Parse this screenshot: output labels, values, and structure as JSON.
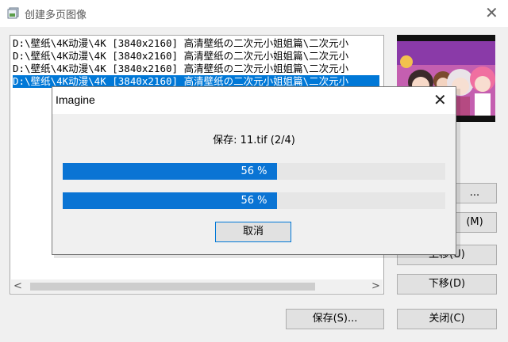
{
  "window": {
    "title": "创建多页图像"
  },
  "file_list": {
    "items": [
      {
        "text": "D:\\壁纸\\4K动漫\\4K [3840x2160] 高清壁纸の二次元小姐姐篇\\二次元小",
        "selected": false
      },
      {
        "text": "D:\\壁纸\\4K动漫\\4K [3840x2160] 高清壁纸の二次元小姐姐篇\\二次元小",
        "selected": false
      },
      {
        "text": "D:\\壁纸\\4K动漫\\4K [3840x2160] 高清壁纸の二次元小姐姐篇\\二次元小",
        "selected": false
      },
      {
        "text": "D:\\壁纸\\4K动漫\\4K [3840x2160] 高清壁纸の二次元小姐姐篇\\二次元小",
        "selected": true
      }
    ],
    "scroll_left": "<",
    "scroll_right": ">"
  },
  "side_buttons": {
    "partial_1": "...",
    "partial_2": "(M)",
    "move_up": "上移(U)",
    "move_down": "下移(D)"
  },
  "bottom_buttons": {
    "save": "保存(S)...",
    "close": "关闭(C)"
  },
  "dialog": {
    "title": "Imagine",
    "close": "✕",
    "status": "保存: 11.tif (2/4)",
    "progress_1": {
      "value": 0.56,
      "label": "56 %"
    },
    "progress_2": {
      "value": 0.56,
      "label": "56 %"
    },
    "cancel": "取消"
  },
  "colors": {
    "accent": "#0078d7",
    "progress": "#0a74d4"
  }
}
